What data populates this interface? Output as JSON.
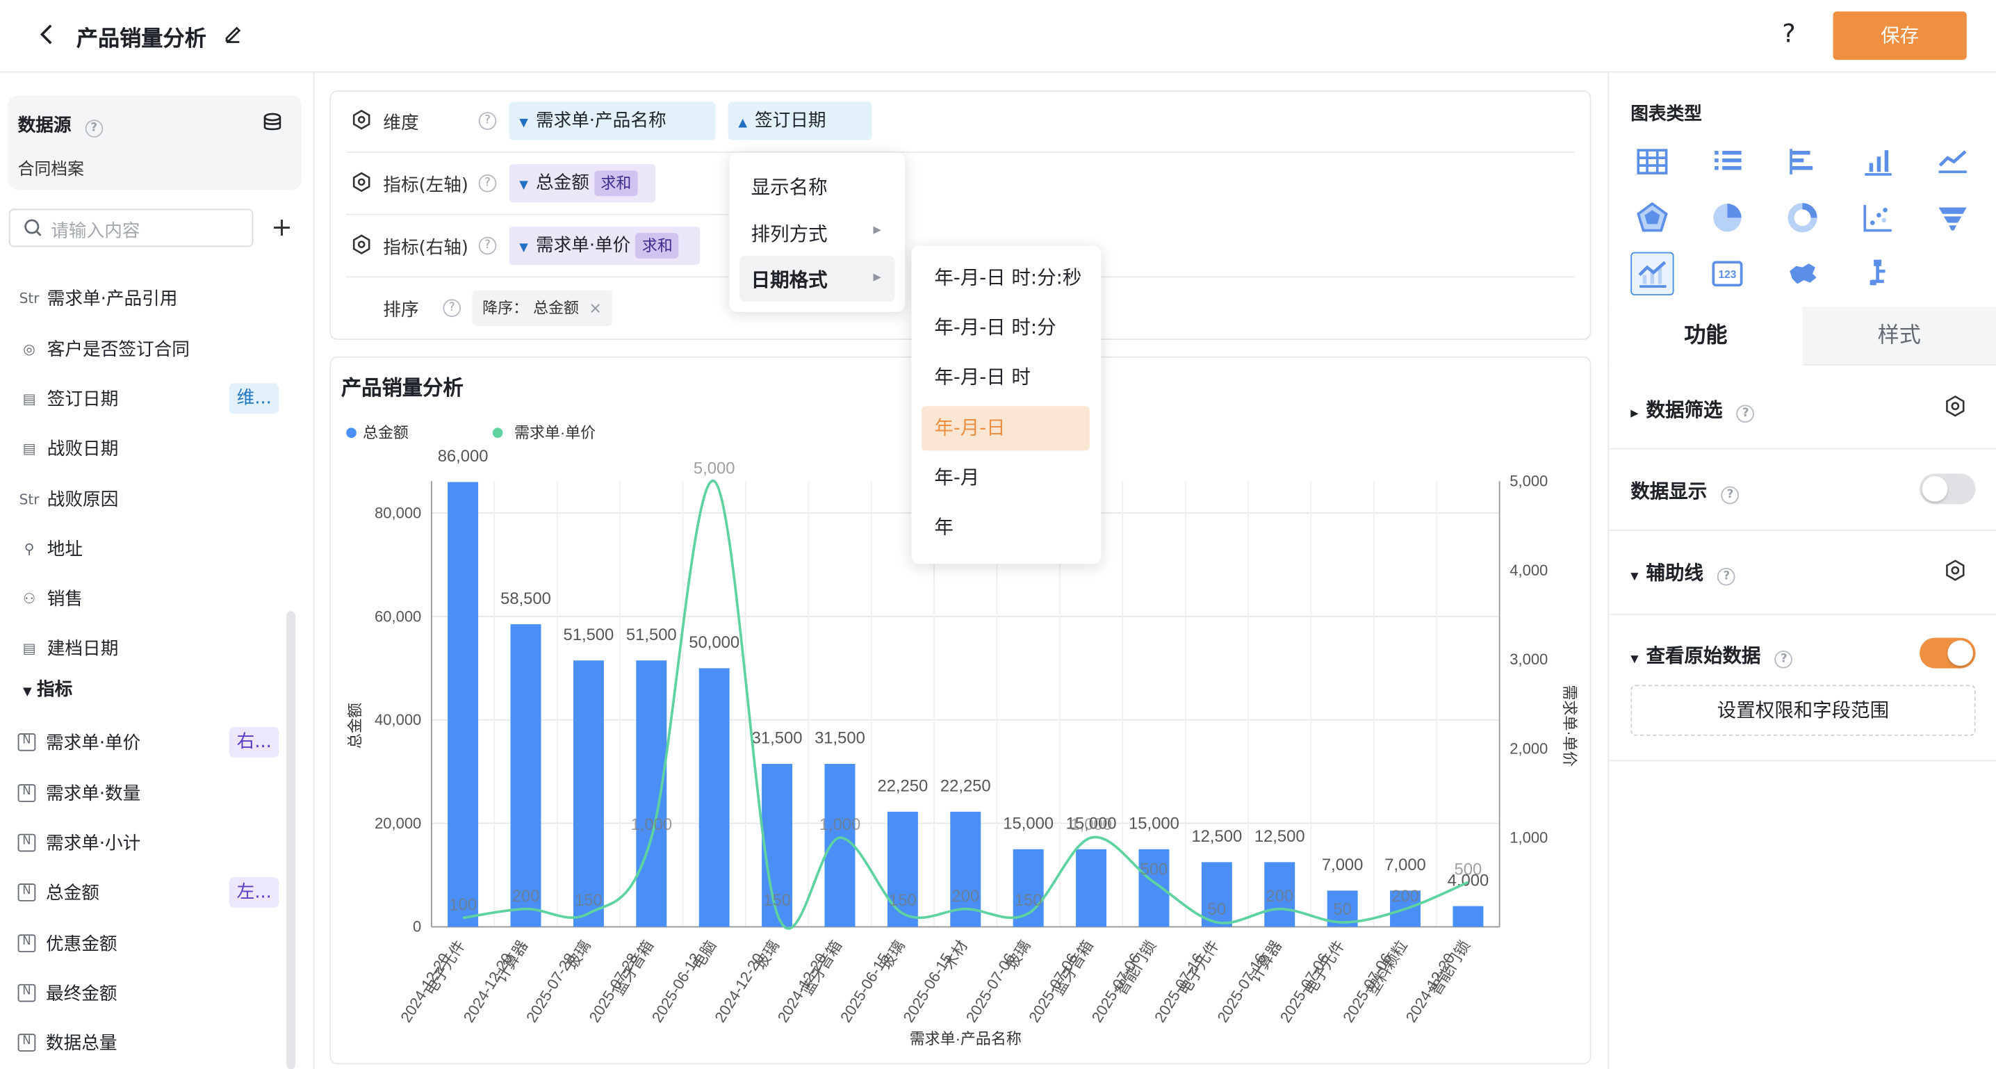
{
  "header": {
    "title": "产品销量分析",
    "save_label": "保存",
    "help": "?"
  },
  "left": {
    "datasource_label": "数据源",
    "datasource_name": "合同档案",
    "search_placeholder": "请输入内容",
    "fields": [
      {
        "icon": "Str",
        "name": "需求单·产品引用",
        "badge": ""
      },
      {
        "icon": "◎",
        "name": "客户是否签订合同",
        "badge": ""
      },
      {
        "icon": "▤",
        "name": "签订日期",
        "badge": "维..."
      },
      {
        "icon": "▤",
        "name": "战败日期",
        "badge": ""
      },
      {
        "icon": "Str",
        "name": "战败原因",
        "badge": ""
      },
      {
        "icon": "⚲",
        "name": "地址",
        "badge": ""
      },
      {
        "icon": "⚇",
        "name": "销售",
        "badge": ""
      },
      {
        "icon": "▤",
        "name": "建档日期",
        "badge": ""
      }
    ],
    "section_metrics": "指标",
    "metrics": [
      {
        "icon": "N",
        "name": "需求单·单价",
        "badge": "右..."
      },
      {
        "icon": "N",
        "name": "需求单·数量",
        "badge": ""
      },
      {
        "icon": "N",
        "name": "需求单·小计",
        "badge": ""
      },
      {
        "icon": "N",
        "name": "总金额",
        "badge": "左..."
      },
      {
        "icon": "N",
        "name": "优惠金额",
        "badge": ""
      },
      {
        "icon": "N",
        "name": "最终金额",
        "badge": ""
      },
      {
        "icon": "N",
        "name": "数据总量",
        "badge": ""
      }
    ]
  },
  "config": {
    "dimension_label": "维度",
    "dim_chip_1": "需求单·产品名称",
    "dim_chip_2": "签订日期",
    "left_axis_label": "指标(左轴)",
    "left_chip": "总金额",
    "left_agg": "求和",
    "right_axis_label": "指标(右轴)",
    "right_chip": "需求单·单价",
    "right_agg": "求和",
    "sort_label": "排序",
    "sort_chip": "降序： 总金额",
    "sort_close": "×"
  },
  "dropdown": {
    "items": [
      "显示名称",
      "排列方式",
      "日期格式"
    ],
    "active": "日期格式",
    "formats": [
      "年-月-日 时:分:秒",
      "年-月-日 时:分",
      "年-月-日 时",
      "年-月-日",
      "年-月",
      "年"
    ],
    "selected_format": "年-月-日"
  },
  "chart_title": "产品销量分析",
  "chart_data": {
    "type": "bar+line",
    "legend": [
      "总金额",
      "需求单·单价"
    ],
    "xlabel": "需求单·产品名称",
    "ylabel_left": "总金额",
    "ylabel_right": "需求单·单价",
    "ylim_left": [
      0,
      80000
    ],
    "ylim_right": [
      0,
      5000
    ],
    "yticks_left": [
      "0",
      "20,000",
      "40,000",
      "60,000",
      "80,000"
    ],
    "yticks_right": [
      "1,000",
      "2,000",
      "3,000",
      "4,000",
      "5,000"
    ],
    "categories": [
      [
        "电子元件",
        "2024-12-20"
      ],
      [
        "计算器",
        "2024-12-20"
      ],
      [
        "玻璃",
        "2025-07-28"
      ],
      [
        "蓝牙音箱",
        "2025-07-28"
      ],
      [
        "电脑",
        "2025-06-12"
      ],
      [
        "玻璃",
        "2024-12-20"
      ],
      [
        "蓝牙音箱",
        "2024-12-20"
      ],
      [
        "玻璃",
        "2025-06-15"
      ],
      [
        "木材",
        "2025-06-15"
      ],
      [
        "玻璃",
        "2025-07-06"
      ],
      [
        "蓝牙音箱",
        "2025-07-06"
      ],
      [
        "智能门锁",
        "2025-07-06"
      ],
      [
        "电子元件",
        "2025-07-16"
      ],
      [
        "计算器",
        "2025-07-16"
      ],
      [
        "电子元件",
        "2025-07-06"
      ],
      [
        "塑料颗粒",
        "2025-07-06"
      ],
      [
        "智能门锁",
        "2024-12-20"
      ]
    ],
    "series": [
      {
        "name": "总金额",
        "axis": "left",
        "color": "#4a8ff5",
        "values": [
          86000,
          58500,
          51500,
          51500,
          50000,
          31500,
          31500,
          22250,
          22250,
          15000,
          15000,
          15000,
          12500,
          12500,
          7000,
          7000,
          4000
        ],
        "labels": [
          "86,000",
          "58,500",
          "51,500",
          "51,500",
          "50,000",
          "31,500",
          "31,500",
          "22,250",
          "22,250",
          "15,000",
          "15,000",
          "15,000",
          "12,500",
          "12,500",
          "7,000",
          "7,000",
          "4,000"
        ]
      },
      {
        "name": "需求单·单价",
        "axis": "right",
        "color": "#5ed3a0",
        "values": [
          100,
          200,
          150,
          1000,
          5000,
          150,
          1000,
          150,
          200,
          150,
          1000,
          500,
          50,
          200,
          50,
          200,
          500
        ],
        "labels": [
          "100",
          "200",
          "150",
          "1,000",
          "5,000",
          "150",
          "1,000",
          "150",
          "200",
          "150",
          "1,000",
          "500",
          "50",
          "200",
          "50",
          "200",
          "500"
        ]
      }
    ]
  },
  "right": {
    "chart_type_title": "图表类型",
    "tab_function": "功能",
    "tab_style": "样式",
    "data_filter": "数据筛选",
    "data_display": "数据显示",
    "aux_line": "辅助线",
    "view_raw": "查看原始数据",
    "perm_button": "设置权限和字段范围",
    "accent": "#ee8f42"
  }
}
